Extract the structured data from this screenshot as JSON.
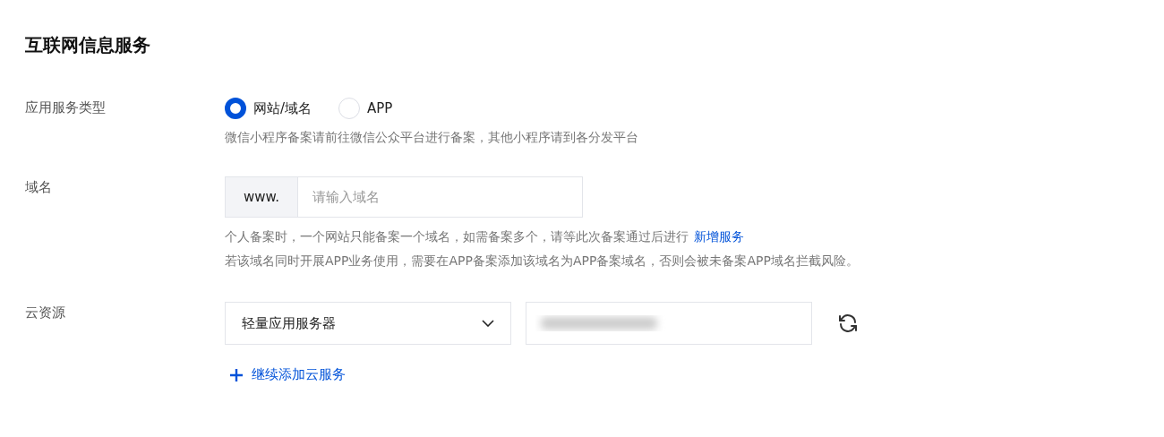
{
  "title": "互联网信息服务",
  "service_type": {
    "label": "应用服务类型",
    "options": [
      {
        "label": "网站/域名",
        "selected": true
      },
      {
        "label": "APP",
        "selected": false
      }
    ],
    "hint": "微信小程序备案请前往微信公众平台进行备案，其他小程序请到各分发平台"
  },
  "domain": {
    "label": "域名",
    "prefix": "www.",
    "placeholder": "请输入域名",
    "hint_lines": [
      {
        "text": "个人备案时，一个网站只能备案一个域名，如需备案多个，请等此次备案通过后进行",
        "link": "新增服务"
      },
      {
        "text": "若该域名同时开展APP业务使用，需要在APP备案添加该域名为APP备案域名，否则会被未备案APP域名拦截风险。"
      }
    ]
  },
  "cloud": {
    "label": "云资源",
    "select_value": "轻量应用服务器",
    "add_link": "继续添加云服务"
  }
}
